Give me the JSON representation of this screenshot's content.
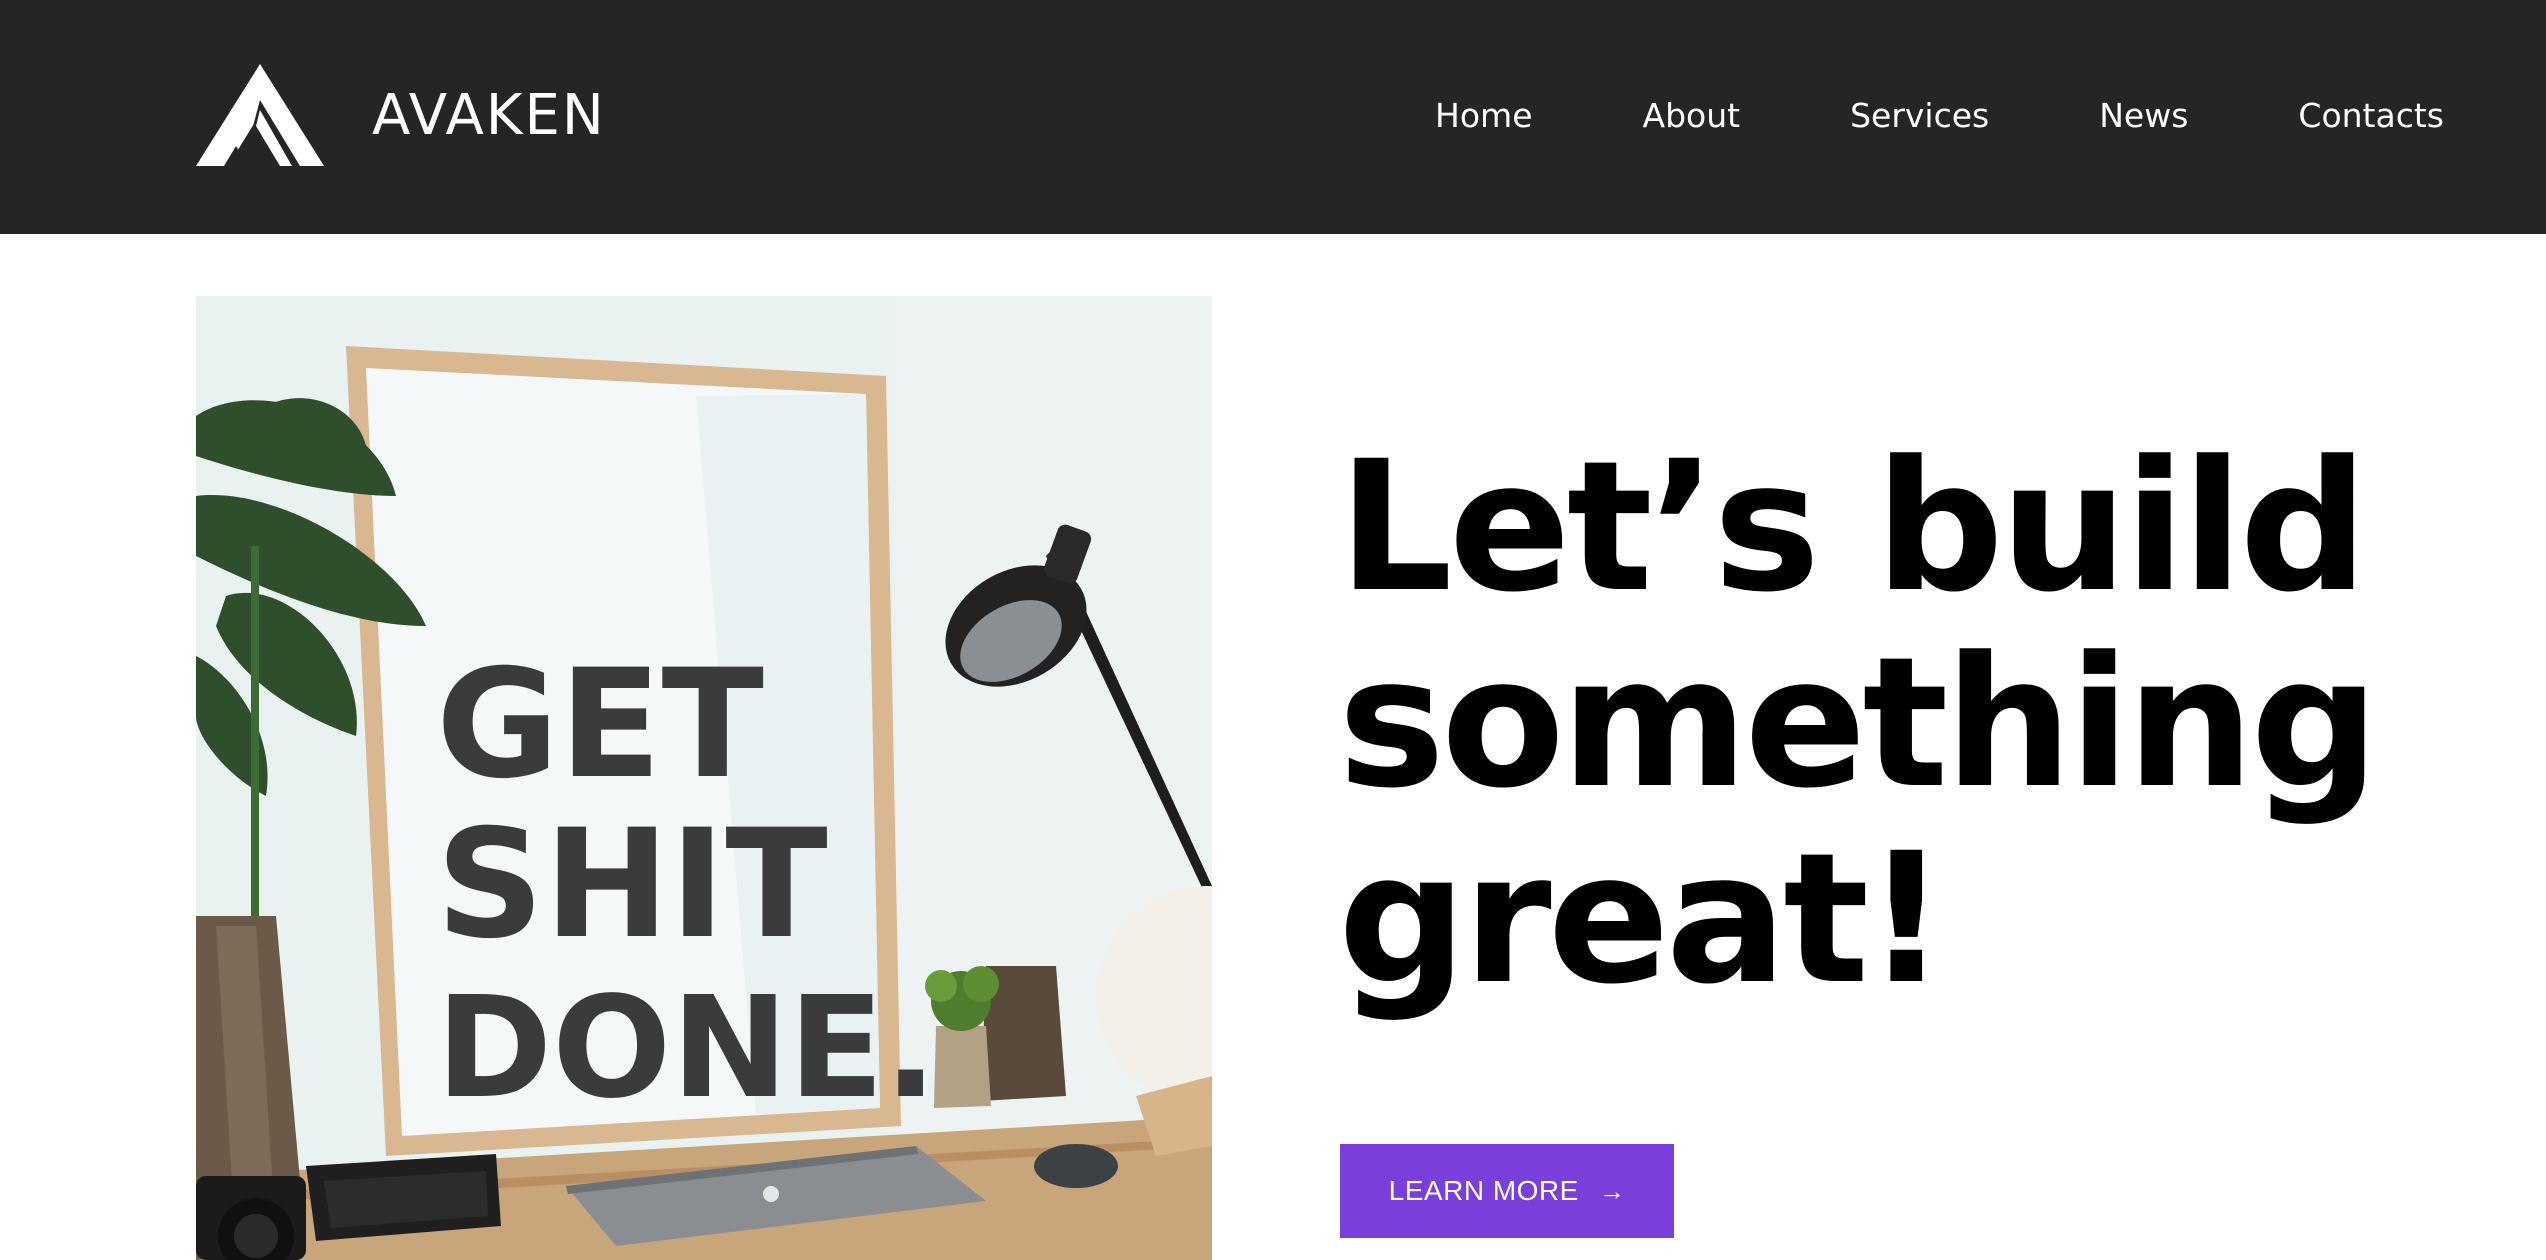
{
  "brand": {
    "name": "AVAKEN",
    "logo_icon": "mountain-logo-icon"
  },
  "nav": {
    "items": [
      {
        "label": "Home"
      },
      {
        "label": "About"
      },
      {
        "label": "Services"
      },
      {
        "label": "News"
      },
      {
        "label": "Contacts"
      }
    ]
  },
  "hero": {
    "headline_lines": [
      "Let’s build",
      "something",
      "great!"
    ],
    "cta_label": "LEARN MORE",
    "cta_icon": "arrow-right-icon",
    "poster_text": [
      "GET",
      "SHIT",
      "DONE."
    ]
  },
  "colors": {
    "header_bg": "#252525",
    "accent": "#7a3fdb",
    "text": "#000000"
  }
}
